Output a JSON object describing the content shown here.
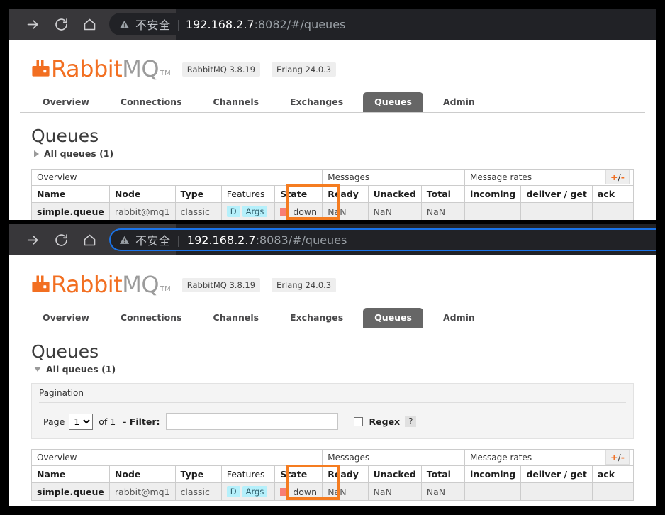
{
  "panels": [
    {
      "id": "panel-top",
      "browser": {
        "back_icon": "arrow-right-icon",
        "reload_icon": "reload-icon",
        "home_icon": "home-icon",
        "security_icon": "warning-triangle-icon",
        "security_label": "不安全",
        "separator": "|",
        "url_host": "192.168.2.7",
        "url_rest": ":8082/#/queues",
        "focused": false
      },
      "brand": {
        "logo_mark": "rabbitmq-logo-icon",
        "name_primary": "Rabbit",
        "name_secondary": "MQ",
        "trademark": "TM",
        "version_pill": "RabbitMQ 3.8.19",
        "erlang_pill": "Erlang 24.0.3"
      },
      "tabs": [
        {
          "label": "Overview",
          "active": false
        },
        {
          "label": "Connections",
          "active": false
        },
        {
          "label": "Channels",
          "active": false
        },
        {
          "label": "Exchanges",
          "active": false
        },
        {
          "label": "Queues",
          "active": true
        },
        {
          "label": "Admin",
          "active": false
        }
      ],
      "page_title": "Queues",
      "all_queues_toggle": {
        "label": "All queues (1)",
        "expanded": false
      },
      "show_pagination": false
    },
    {
      "id": "panel-bottom",
      "browser": {
        "back_icon": "arrow-right-icon",
        "reload_icon": "reload-icon",
        "home_icon": "home-icon",
        "security_icon": "warning-triangle-icon",
        "security_label": "不安全",
        "separator": "|",
        "url_host": "192.168.2.7",
        "url_rest": ":8083/#/queues",
        "focused": true
      },
      "brand": {
        "logo_mark": "rabbitmq-logo-icon",
        "name_primary": "Rabbit",
        "name_secondary": "MQ",
        "trademark": "TM",
        "version_pill": "RabbitMQ 3.8.19",
        "erlang_pill": "Erlang 24.0.3"
      },
      "tabs": [
        {
          "label": "Overview",
          "active": false
        },
        {
          "label": "Connections",
          "active": false
        },
        {
          "label": "Channels",
          "active": false
        },
        {
          "label": "Exchanges",
          "active": false
        },
        {
          "label": "Queues",
          "active": true
        },
        {
          "label": "Admin",
          "active": false
        }
      ],
      "page_title": "Queues",
      "all_queues_toggle": {
        "label": "All queues (1)",
        "expanded": true
      },
      "show_pagination": true,
      "pagination": {
        "legend": "Pagination",
        "page_label": "Page",
        "page_value": "1",
        "page_options": [
          "1"
        ],
        "of_label": "of 1",
        "filter_label": "- Filter:",
        "filter_value": "",
        "filter_placeholder": "",
        "regex_label": "Regex",
        "regex_checked": false,
        "help_label": "?"
      }
    }
  ],
  "table": {
    "group_headers": [
      {
        "label": "Overview",
        "span": 5
      },
      {
        "label": "Messages",
        "span": 3
      },
      {
        "label": "Message rates",
        "span": 3
      }
    ],
    "columns": [
      {
        "label": "Name",
        "align": "left"
      },
      {
        "label": "Node",
        "align": "left"
      },
      {
        "label": "Type",
        "align": "left"
      },
      {
        "label": "Features",
        "align": "left"
      },
      {
        "label": "State",
        "align": "left"
      },
      {
        "label": "Ready",
        "align": "right"
      },
      {
        "label": "Unacked",
        "align": "right"
      },
      {
        "label": "Total",
        "align": "right"
      },
      {
        "label": "incoming",
        "align": "left"
      },
      {
        "label": "deliver / get",
        "align": "left"
      },
      {
        "label": "ack",
        "align": "left"
      }
    ],
    "rows": [
      {
        "name": "simple.queue",
        "node": "rabbit@mq1",
        "type": "classic",
        "features": [
          "D",
          "Args"
        ],
        "state": "down",
        "state_color": "#f77f75",
        "ready": "NaN",
        "unacked": "NaN",
        "total": "NaN",
        "incoming": "",
        "deliver_get": "",
        "ack": ""
      }
    ],
    "plus_minus": {
      "plus": "+",
      "slash": "/",
      "minus": "-"
    }
  },
  "colors": {
    "accent_orange": "#f26f21",
    "annotation_orange": "#f57c20",
    "focus_blue": "#1a73e8",
    "active_tab_grey": "#666666",
    "state_down_red": "#f77f75",
    "feature_badge_blue": "#b5f0fb"
  }
}
